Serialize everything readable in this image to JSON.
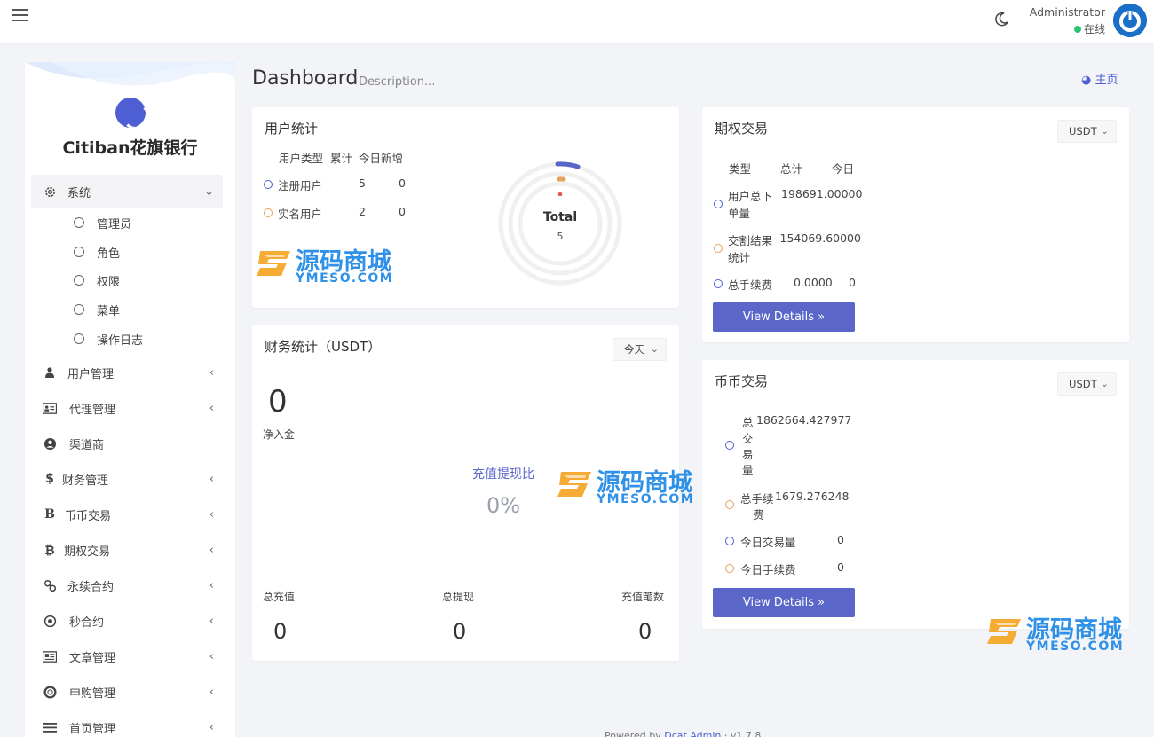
{
  "topbar": {
    "admin_name": "Administrator",
    "status": "在线"
  },
  "sidebar": {
    "brand": "Citiban花旗银行",
    "system": {
      "label": "系统",
      "sub": [
        "管理员",
        "角色",
        "权限",
        "菜单",
        "操作日志"
      ]
    },
    "items": [
      {
        "label": "用户管理"
      },
      {
        "label": "代理管理"
      },
      {
        "label": "渠道商"
      },
      {
        "label": "财务管理"
      },
      {
        "label": "币币交易"
      },
      {
        "label": "期权交易"
      },
      {
        "label": "永续合约"
      },
      {
        "label": "秒合约"
      },
      {
        "label": "文章管理"
      },
      {
        "label": "申购管理"
      },
      {
        "label": "首页管理"
      }
    ],
    "icons": {
      "dollar": "$",
      "bitcoin_b": "B",
      "bitcoin": "₿"
    }
  },
  "header": {
    "title": "Dashboard",
    "description": "Description...",
    "home": "主页"
  },
  "user_stats": {
    "title": "用户统计",
    "headers": [
      "用户类型",
      "累计",
      "今日新增"
    ],
    "rows": [
      {
        "type": "注册用户",
        "total": "5",
        "today": "0"
      },
      {
        "type": "实名用户",
        "total": "2",
        "today": "0"
      }
    ],
    "donut_label": "Total",
    "donut_value": "5"
  },
  "finance": {
    "title": "财务统计（USDT）",
    "period": "今天",
    "net": "0",
    "net_label": "净入金",
    "ratio_label": "充值提现比",
    "ratio_value": "0%",
    "bottom": [
      {
        "label": "总充值",
        "value": "0"
      },
      {
        "label": "总提现",
        "value": "0"
      },
      {
        "label": "充值笔数",
        "value": "0"
      }
    ]
  },
  "options": {
    "title": "期权交易",
    "currency": "USDT",
    "headers": [
      "类型",
      "总计",
      "今日"
    ],
    "rows": [
      {
        "type_l1": "用户总下",
        "type_l2": "单量",
        "total": "198691.00000",
        "today": ""
      },
      {
        "type_l1": "交割结果",
        "type_l2": "统计",
        "total": "-154069.60000",
        "today": ""
      },
      {
        "type_l1": "总手续费",
        "type_l2": "",
        "total": "0.0000",
        "today": "0"
      }
    ],
    "button": "View Details »"
  },
  "coin": {
    "title": "币币交易",
    "currency": "USDT",
    "rows": [
      {
        "type_lines": [
          "总",
          "交",
          "易",
          "量"
        ],
        "value": "1862664.427977"
      },
      {
        "type_lines": [
          "总手续",
          "费"
        ],
        "value": "1679.276248"
      },
      {
        "type_lines": [
          "今日交易量"
        ],
        "value": "0"
      },
      {
        "type_lines": [
          "今日手续费"
        ],
        "value": "0"
      }
    ],
    "button": "View Details »"
  },
  "watermark": {
    "text": "源码商城",
    "sub": "YMESO.COM"
  },
  "footer": {
    "prefix": "Powered by ",
    "link": "Dcat Admin",
    "version": "· v1.7.8"
  },
  "colors": {
    "accent": "#5a67c9",
    "online": "#28c76f",
    "orange": "#e0a45a"
  }
}
